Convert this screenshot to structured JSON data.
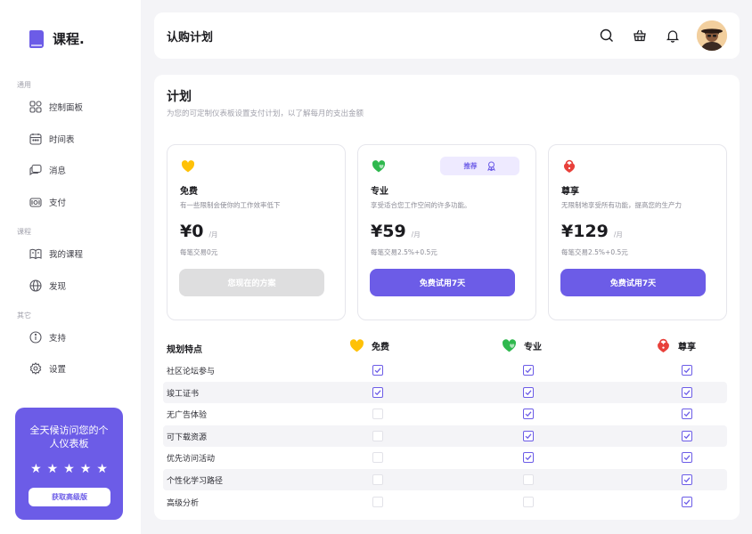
{
  "app": {
    "logo_text": "课程."
  },
  "sidebar": {
    "sections": [
      {
        "label": "通用"
      },
      {
        "label": "课程"
      },
      {
        "label": "其它"
      }
    ],
    "items": [
      {
        "label": "控制面板",
        "icon": "grid-icon"
      },
      {
        "label": "时间表",
        "icon": "calendar-icon"
      },
      {
        "label": "消息",
        "icon": "chat-icon"
      },
      {
        "label": "支付",
        "icon": "wallet-icon"
      },
      {
        "label": "我的课程",
        "icon": "book-icon"
      },
      {
        "label": "发现",
        "icon": "globe-icon"
      },
      {
        "label": "支持",
        "icon": "info-icon"
      },
      {
        "label": "设置",
        "icon": "gear-icon"
      }
    ],
    "promo": {
      "text": "全天候访问您的个人仪表板",
      "stars": 5,
      "button": "获取高级版"
    }
  },
  "header": {
    "title": "认购计划",
    "icons": [
      "search-icon",
      "basket-icon",
      "bell-icon",
      "avatar"
    ]
  },
  "main": {
    "title": "计划",
    "subtitle": "为您的可定制仪表板设置支付计划，以了解每月的支出金额",
    "plans": [
      {
        "name": "免费",
        "desc": "有一些限制会使你的工作效率低下",
        "price": "¥0",
        "period": "/月",
        "fee": "每笔交易0元",
        "button": "您现在的方案",
        "icon": "yellow-heart-icon",
        "color": "#ffc107"
      },
      {
        "name": "专业",
        "desc": "享受适合您工作空间的许多功能。",
        "price": "¥59",
        "period": "/月",
        "fee": "每笔交易2.5%+0.5元",
        "button": "免费试用7天",
        "badge": "推荐",
        "icon": "green-heart-icon",
        "color": "#2fb84e"
      },
      {
        "name": "尊享",
        "desc": "无限制地享受所有功能，提高您的生产力",
        "price": "¥129",
        "period": "/月",
        "fee": "每笔交易2.5%+0.5元",
        "button": "免费试用7天",
        "icon": "red-lock-icon",
        "color": "#e8403a"
      }
    ],
    "features_header": "规划特点",
    "features": [
      {
        "label": "社区论坛参与",
        "free": true,
        "pro": true,
        "premium": true
      },
      {
        "label": "竣工证书",
        "free": true,
        "pro": true,
        "premium": true
      },
      {
        "label": "无广告体验",
        "free": false,
        "pro": true,
        "premium": true
      },
      {
        "label": "可下载资源",
        "free": false,
        "pro": true,
        "premium": true
      },
      {
        "label": "优先访问活动",
        "free": false,
        "pro": true,
        "premium": true
      },
      {
        "label": "个性化学习路径",
        "free": false,
        "pro": false,
        "premium": true
      },
      {
        "label": "高级分析",
        "free": false,
        "pro": false,
        "premium": true
      }
    ]
  }
}
